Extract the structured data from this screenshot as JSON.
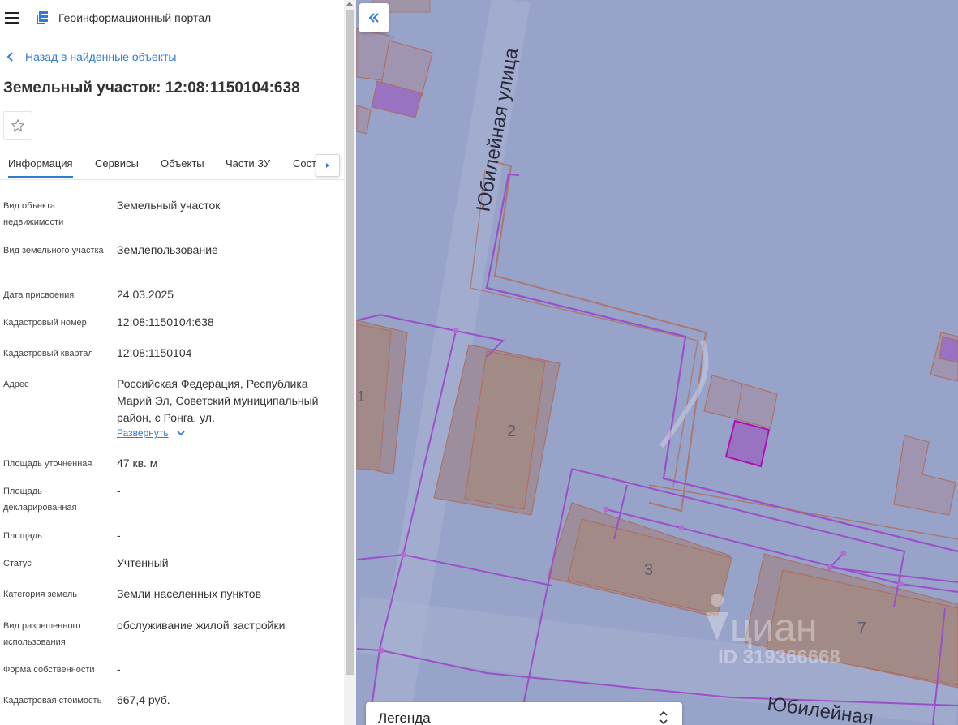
{
  "app": {
    "title": "Геоинформационный портал",
    "brand_color": "#2f7bd8"
  },
  "nav": {
    "back_label": "Назад в найденные объекты"
  },
  "object": {
    "title": "Земельный участок: 12:08:1150104:638"
  },
  "tabs": [
    {
      "label": "Информация",
      "active": true
    },
    {
      "label": "Сервисы"
    },
    {
      "label": "Объекты"
    },
    {
      "label": "Части ЗУ"
    },
    {
      "label": "Состав"
    }
  ],
  "info": [
    {
      "label": "Вид объекта недвижимости",
      "value": "Земельный участок"
    },
    {
      "label": "Вид земельного участка",
      "value": "Землепользование"
    },
    {
      "label": "Дата присвоения",
      "value": "24.03.2025"
    },
    {
      "label": "Кадастровый номер",
      "value": "12:08:1150104:638"
    },
    {
      "label": "Кадастровый квартал",
      "value": "12:08:1150104"
    },
    {
      "label": "Адрес",
      "value": "Российская Федерация, Республика Марий Эл, Советский муниципальный район, с Ронга, ул."
    },
    {
      "label": "Площадь уточненная",
      "value": "47 кв. м"
    },
    {
      "label": "Площадь декларированная",
      "value": "-"
    },
    {
      "label": "Площадь",
      "value": "-"
    },
    {
      "label": "Статус",
      "value": "Учтенный"
    },
    {
      "label": "Категория земель",
      "value": "Земли населенных пунктов"
    },
    {
      "label": "Вид разрешенного использования",
      "value": "обслуживание жилой застройки"
    },
    {
      "label": "Форма собственности",
      "value": "-"
    },
    {
      "label": "Кадастровая стоимость",
      "value": "667,4 руб."
    }
  ],
  "address_expand_label": "Развернуть",
  "map": {
    "street_label_1": "Юбилейная улица",
    "street_label_2": "Юбилейная",
    "building_numbers": [
      "1",
      "2",
      "3",
      "7"
    ],
    "watermark_text": "циан",
    "watermark_id": "ID 319366668",
    "legend_label": "Легенда"
  }
}
